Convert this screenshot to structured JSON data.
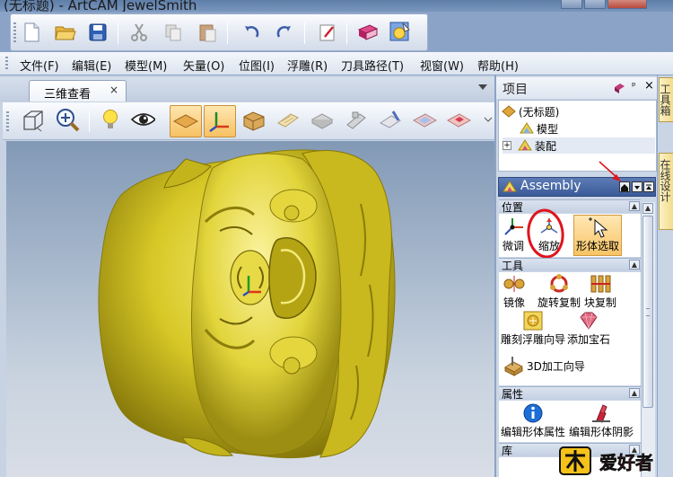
{
  "window": {
    "title": "(无标题) - ArtCAM JewelSmith"
  },
  "menu": [
    "文件(F)",
    "编辑(E)",
    "模型(M)",
    "矢量(O)",
    "位图(I)",
    "浮雕(R)",
    "刀具路径(T)",
    "视窗(W)",
    "帮助(H)"
  ],
  "document_tab": {
    "label": "三维查看",
    "close": "×"
  },
  "project_panel": {
    "title": "项目",
    "pin": "ᵖ",
    "close": "×",
    "tree": [
      {
        "label": "(无标题)",
        "icon": "project-icon"
      },
      {
        "label": "模型",
        "icon": "model-icon"
      },
      {
        "label": "装配",
        "icon": "assembly-icon",
        "expander": "+"
      }
    ]
  },
  "assembly_panel": {
    "title": "Assembly",
    "sections": [
      {
        "title": "位置",
        "tools": [
          {
            "label": "微调",
            "icon": "nudge-icon"
          },
          {
            "label": "缩放",
            "icon": "scale-icon",
            "highlighted": true
          },
          {
            "label": "形体选取",
            "icon": "shape-select-icon",
            "active": true
          }
        ]
      },
      {
        "title": "工具",
        "tools": [
          {
            "label": "镜像",
            "icon": "mirror-icon"
          },
          {
            "label": "旋转复制",
            "icon": "rotate-copy-icon"
          },
          {
            "label": "块复制",
            "icon": "block-copy-icon"
          },
          {
            "label": "雕刻浮雕向导",
            "icon": "relief-wizard-icon"
          },
          {
            "label": "添加宝石",
            "icon": "add-gem-icon"
          },
          {
            "label": "3D加工向导",
            "icon": "machining-wizard-icon"
          }
        ]
      },
      {
        "title": "属性",
        "tools": [
          {
            "label": "编辑形体属性",
            "icon": "info-icon"
          },
          {
            "label": "编辑形体阴影",
            "icon": "shading-icon"
          }
        ]
      },
      {
        "title": "库",
        "tools": []
      }
    ]
  },
  "side_tabs": [
    "工具箱",
    "在线设计"
  ],
  "watermark": {
    "text": "木工爱好者"
  },
  "colors": {
    "accent": "#3a5a98",
    "model_gold": "#d8cb2c",
    "annotation_red": "#e0141c"
  }
}
